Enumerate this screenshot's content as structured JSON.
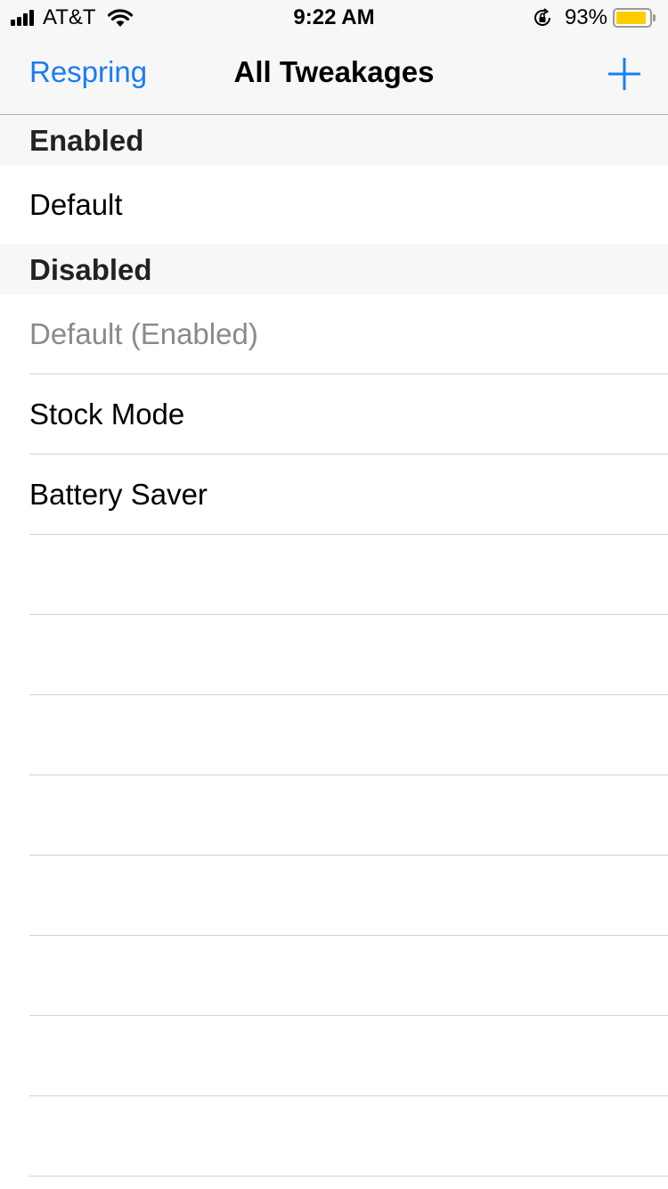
{
  "status_bar": {
    "carrier": "AT&T",
    "time": "9:22 AM",
    "battery_percent": "93%",
    "battery_level": 0.93,
    "battery_color": "#ffcc00",
    "icons": [
      "signal-icon",
      "wifi-icon",
      "orientation-lock-icon",
      "battery-icon"
    ]
  },
  "nav": {
    "left_button": "Respring",
    "title": "All Tweakages",
    "right_icon": "plus-icon",
    "accent_color": "#1a7cf5"
  },
  "sections": {
    "enabled": {
      "title": "Enabled",
      "items": [
        "Default"
      ]
    },
    "disabled": {
      "title": "Disabled",
      "items": [
        "Default (Enabled)",
        "Stock Mode",
        "Battery Saver"
      ]
    }
  }
}
